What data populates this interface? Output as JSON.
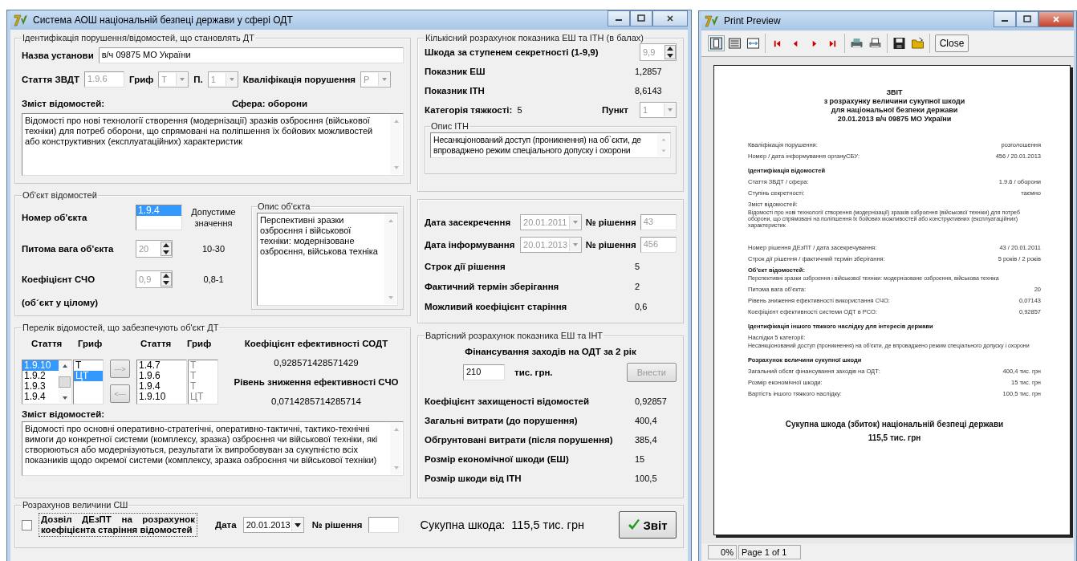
{
  "main_window": {
    "title": "Система АОШ національній безпеці держави у сфері ОДТ"
  },
  "identification": {
    "legend": "Ідентифікація порушення/відомостей, що становлять ДТ",
    "institution": {
      "label": "Назва установи",
      "value": "в/ч 09875 МО України",
      "disabled": false
    },
    "article": {
      "label": "Стаття ЗВДТ",
      "value": "1.9.6",
      "disabled": true
    },
    "grif": {
      "label": "Гриф",
      "value": "Т",
      "disabled": true
    },
    "item": {
      "label": "П.",
      "value": "1",
      "disabled": true
    },
    "qualification": {
      "label": "Кваліфікація порушення",
      "value": "Р",
      "disabled": true
    },
    "content_label": "Зміст відомостей:",
    "sphere": "Сфера:  оборони",
    "content": "Відомості про нові технології створення (модернізації) зразків озброєння (військової техніки) для потреб оборони, що спрямовані на поліпшення їх бойових можливостей або конструктивних (експлуатаційних) характеристик"
  },
  "object": {
    "legend": "Об'єкт відомостей",
    "number_label": "Номер об'єкта",
    "number_options": [
      {
        "text": "1.9.4",
        "selected": true
      }
    ],
    "allowed_label": "Допустиме значення",
    "weight": {
      "label": "Питома вага об'єкта",
      "value": "20",
      "range": "10-30",
      "disabled": true
    },
    "coefficient": {
      "label": "Коефіцієнт СЧО",
      "value": "0,9",
      "range": "0,8-1",
      "disabled": true
    },
    "note": "(об´єкт у цілому)",
    "description_legend": "Опис об'єкта",
    "description": "Перспективні зразки озброєння і військової техніки: модернізоване озброєння, військова техніка"
  },
  "list": {
    "legend": "Перелік відомостей, що забезпечують об'єкт ДТ",
    "headers": [
      "Стаття",
      "Гриф",
      "Стаття",
      "Гриф"
    ],
    "available_articles": [
      {
        "text": "1.9.10",
        "selected": true
      },
      {
        "text": "1.9.2",
        "selected": false
      },
      {
        "text": "1.9.3",
        "selected": false
      },
      {
        "text": "1.9.4",
        "selected": false
      }
    ],
    "available_grifs": [
      {
        "text": "Т",
        "selected": false
      },
      {
        "text": "ЦТ",
        "selected": true
      }
    ],
    "add_button": {
      "label": "--->",
      "disabled": true
    },
    "remove_button": {
      "label": "<---",
      "disabled": true
    },
    "chosen_articles": [
      "1.4.7",
      "1.9.6",
      "1.9.4",
      "1.9.10"
    ],
    "chosen_grifs": [
      "Т",
      "Т",
      "Т",
      "ЦТ"
    ],
    "efficiency_label": "Коефіцієнт ефективності СОДТ",
    "efficiency": "0,928571428571429",
    "reduction_label": "Рівень зниження ефективності СЧО",
    "reduction": "0,0714285714285714",
    "content_label": "Зміст відомостей:",
    "content": "Відомості про основні оперативно-стратегічні, оперативно-тактичні, тактико-технічні вимоги до конкретної системи (комплексу, зразка) озброєння чи військової техніки, які створюються або модернізуються, результати їх випробовуван за сукупністю всіх показників щодо окремої системи (комплексу, зразка озброєння чи військової техніки)"
  },
  "calculation": {
    "legend": "Розрахунов величини СШ",
    "permission": {
      "label": "Дозвіл ДЕзПТ на розрахунок коефіцієнта старіння відомостей",
      "checked": false
    },
    "date_label": "Дата",
    "date": "20.01.2013",
    "decision_label": "№ рішення",
    "total_label": "Сукупна шкода:",
    "total": "115,5 тис. грн",
    "report_button": "Звіт"
  },
  "quantitative": {
    "legend": "Кількісний розрахунок показника ЕШ та ІТН (в балах)",
    "damage": {
      "label": "Шкода за ступенем секретності (1-9,9)",
      "value": "9,9",
      "disabled": true
    },
    "indicators": [
      {
        "label": "Показник ЕШ",
        "value": "1,2857"
      },
      {
        "label": "Показник ІТН",
        "value": "8,6143"
      }
    ],
    "category_label": "Категорія тяжкості:",
    "category": "5",
    "point": {
      "label": "Пункт",
      "value": "1",
      "disabled": true
    },
    "description_legend": "Опис ІТН",
    "description": "Несанкціонований доступ (проникнення) на об`єкти, де впроваджено режим спеціального допуску і охорони"
  },
  "dates": {
    "rows": [
      {
        "label": "Дата засекречення",
        "date": "20.01.2011",
        "decision_label": "№ рішення",
        "decision": "43",
        "disabled": true
      },
      {
        "label": "Дата інформування",
        "date": "20.01.2013",
        "decision_label": "№ рішення",
        "decision": "456",
        "disabled": true
      }
    ],
    "terms": [
      {
        "label": "Строк дії рішення",
        "value": "5"
      },
      {
        "label": "Фактичний термін зберігання",
        "value": "2"
      },
      {
        "label": "Можливий коефіцієнт старіння",
        "value": "0,6"
      }
    ]
  },
  "cost": {
    "legend": "Вартісний розрахунок показника ЕШ та ІНТ",
    "funding_label": "Фінансування заходів на ОДТ за 2 рік",
    "funding": "210",
    "unit": "тис. грн.",
    "apply_button": {
      "label": "Внести",
      "disabled": true
    },
    "rows": [
      {
        "label": "Коефіцієнт захищеності відомостей",
        "value": "0,92857"
      },
      {
        "label": "Загальні витрати (до порушення)",
        "value": "400,4"
      },
      {
        "label": "Обгрунтовані витрати (після порушення)",
        "value": "385,4"
      },
      {
        "label": "Розмір економічної шкоди (ЕШ)",
        "value": "15"
      },
      {
        "label": "Розмір шкоди від ІТН",
        "value": "100,5"
      }
    ]
  },
  "preview": {
    "title": "Print Preview",
    "close_button": "Close",
    "report": {
      "heading": [
        "ЗВІТ",
        "з розрахунку величини сукупної шкоди",
        "для національної безпеки держави",
        "20.01.2013 в/ч 09875 МО України"
      ],
      "rows": [
        {
          "kind": "pair",
          "label": "Кваліфікація порушення:",
          "value": "розголошення"
        },
        {
          "kind": "pair",
          "label": "Номер / дата інформування  органуСБУ:",
          "value": "456 / 20.01.2013"
        },
        {
          "kind": "heading",
          "label": "Ідентифікація відомостей"
        },
        {
          "kind": "pair",
          "label": "Стаття ЗВДТ / сфера:",
          "value": "1.9.6 / оборони"
        },
        {
          "kind": "pair",
          "label": "Ступінь секретності:",
          "value": "таємно"
        },
        {
          "kind": "note",
          "label": "Зміст відомостей:",
          "text": "Відомості про нові технології створення (модернізації) зразків озброєння (військової техніки) для потреб оборони, що спрямовані на поліпшення їх бойових можливостей або конструктивних (експлуатаційних) характеристик"
        },
        {
          "kind": "pair",
          "label": "Номер рішення ДЕзПТ / дата засекречування:",
          "value": "43 / 20.01.2011"
        },
        {
          "kind": "pair",
          "label": "Строк дії рішення / фактичний термін зберігання:",
          "value": "5 років / 2 років"
        },
        {
          "kind": "heading_note",
          "label": "Об'єкт відомостей:",
          "text": "Перспективні зразки озброєння і військової техніки: модернізоване озброєння, військова техніка"
        },
        {
          "kind": "pair",
          "label": "Питома вага об'єкта:",
          "value": "20"
        },
        {
          "kind": "pair",
          "label": "Рівень зниження ефективності використання СЧО:",
          "value": "0,07143"
        },
        {
          "kind": "pair",
          "label": "Коефіцієнт ефективності системи ОДТ в РСО:",
          "value": "0,92857"
        },
        {
          "kind": "heading",
          "label": "Ідентифікація іншого тяжкого наслідку для інтересів держави"
        },
        {
          "kind": "note",
          "label": "Наслідки 5 категорії:",
          "text": "Несанкціонований доступ (проникнення) на об'єкти, де впроваджено режим спеціального допуску і охорони"
        },
        {
          "kind": "heading",
          "label": "Розрахунок величини сукупної шкоди"
        },
        {
          "kind": "pair",
          "label": "Загальний обсяг фінансування заходів на ОДТ:",
          "value": "400,4 тис. грн"
        },
        {
          "kind": "pair",
          "label": "Розмір економічної шкоди:",
          "value": "15 тис. грн"
        },
        {
          "kind": "pair",
          "label": "Вартість іншого тяжкого наслідку:",
          "value": "100,5 тис. грн"
        }
      ],
      "total": [
        "Сукупна шкода (збиток) національній безпеці держави",
        "115,5 тис. грн"
      ]
    },
    "zoom": "0%",
    "page": "Page 1 of 1"
  }
}
